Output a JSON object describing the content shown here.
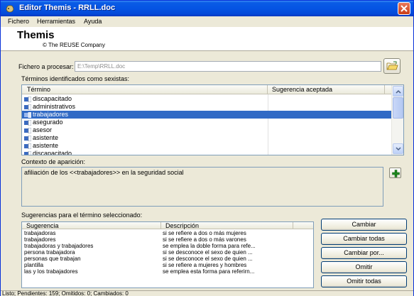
{
  "window": {
    "title": "Editor Themis - RRLL.doc",
    "icon": "app-icon",
    "close_icon": "close-icon"
  },
  "menu": {
    "items": [
      {
        "label": "Fichero"
      },
      {
        "label": "Herramientas"
      },
      {
        "label": "Ayuda"
      }
    ]
  },
  "header": {
    "app_name": "Themis",
    "company": "© The REUSE Company"
  },
  "file": {
    "label": "Fichero a procesar:",
    "value": "E:\\Temp\\RRLL.doc",
    "browse_icon": "folder-open-icon"
  },
  "terms": {
    "label": "Términos identificados como sexistas:",
    "columns": [
      "Término",
      "Sugerencia aceptada"
    ],
    "rows": [
      {
        "term": "discapacitado",
        "accepted": ""
      },
      {
        "term": "administrativos",
        "accepted": ""
      },
      {
        "term": "trabajadores",
        "accepted": "",
        "selected": true
      },
      {
        "term": "asegurado",
        "accepted": ""
      },
      {
        "term": "asesor",
        "accepted": ""
      },
      {
        "term": "asistente",
        "accepted": ""
      },
      {
        "term": "asistente",
        "accepted": ""
      },
      {
        "term": "discapacitado",
        "accepted": ""
      }
    ],
    "row_icon": "document-icon",
    "selected_color": "#316ac5"
  },
  "context": {
    "label": "Contexto de aparición:",
    "text": "afiliación de los <<trabajadores>> en  la  seguridad  social",
    "add_icon": "plus-icon"
  },
  "suggestions": {
    "label": "Sugerencias para el término seleccionado:",
    "columns": [
      "Sugerencia",
      "Descripción"
    ],
    "rows": [
      {
        "suggestion": "trabajadoras",
        "description": "si se refiere a dos o más mujeres"
      },
      {
        "suggestion": "trabajadores",
        "description": "si se refiere a dos o más varones"
      },
      {
        "suggestion": "trabajadoras y trabajadores",
        "description": "se emplea la doble forma para refe..."
      },
      {
        "suggestion": "persona trabajadora",
        "description": "si se desconoce el sexo de quien ..."
      },
      {
        "suggestion": "personas que trabajan",
        "description": "si se desconoce el sexo de quien ..."
      },
      {
        "suggestion": "plantilla",
        "description": "si se refiere a mujeres y hombres"
      },
      {
        "suggestion": "las y los trabajadores",
        "description": "se emplea esta forma para referirn..."
      }
    ]
  },
  "buttons": {
    "cambiar": "Cambiar",
    "cambiar_todas": "Cambiar todas",
    "cambiar_por": "Cambiar por...",
    "omitir": "Omitir",
    "omitir_todas": "Omitir todas"
  },
  "status": {
    "text": "Listo; Pendientes: 159; Omitidos: 0; Cambiados: 0"
  }
}
